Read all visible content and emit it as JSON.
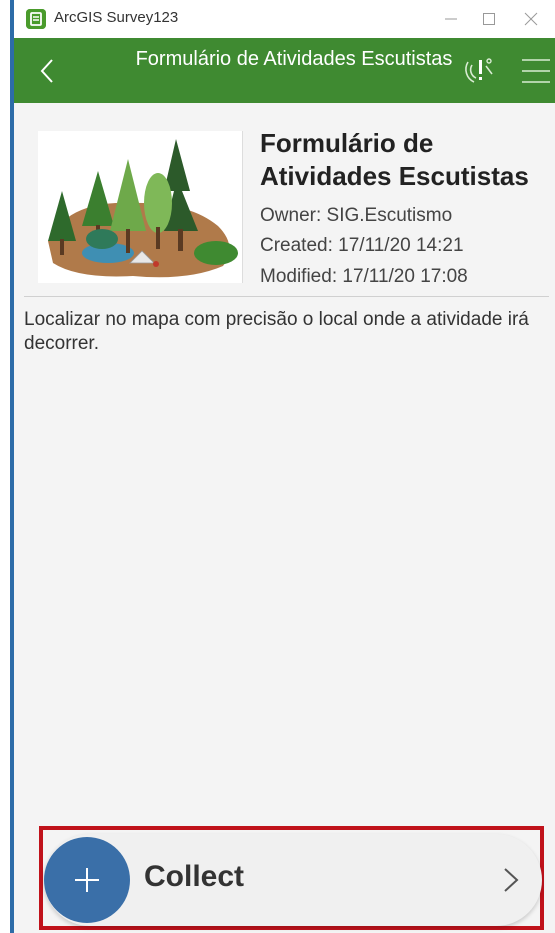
{
  "window": {
    "title": "ArcGIS Survey123",
    "logo_icon": "survey123-logo-icon",
    "minimize_icon": "minimize-icon",
    "maximize_icon": "maximize-icon",
    "close_icon": "close-icon"
  },
  "header": {
    "title": "Formulário de Atividades Escutistas",
    "background_color": "#3f8a31",
    "back_icon": "chevron-left-icon",
    "gps_icon": "gps-status-icon",
    "menu_icon": "hamburger-menu-icon"
  },
  "survey": {
    "title": "Formulário de Atividades Escutistas",
    "owner": "Owner: SIG.Escutismo",
    "created": "Created: 17/11/20 14:21",
    "modified": "Modified: 17/11/20 17:08",
    "thumbnail_icon": "forest-thumbnail-icon",
    "description": "Localizar no mapa com precisão o local onde a atividade irá decorrer."
  },
  "collect": {
    "label": "Collect",
    "plus_icon": "plus-icon",
    "chevron_icon": "chevron-right-icon",
    "accent_color": "#3a6fa8",
    "highlight_color": "#c0121b"
  }
}
